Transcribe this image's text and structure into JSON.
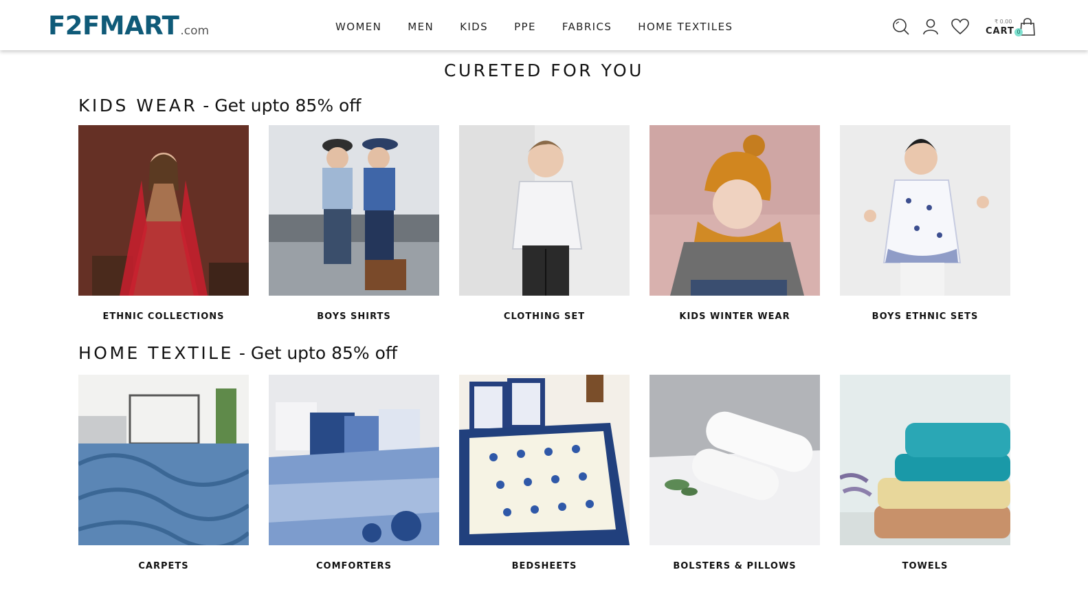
{
  "header": {
    "logo_main": "F2FMART",
    "logo_sub": ".com",
    "nav": [
      "WOMEN",
      "MEN",
      "KIDS",
      "PPE",
      "FABRICS",
      "HOME TEXTILES"
    ],
    "icons": [
      "search-icon",
      "account-icon",
      "wishlist-heart-icon",
      "shopping-bag-icon"
    ],
    "cart": {
      "amount": "₹ 0.00",
      "label": "CART",
      "count": "0"
    }
  },
  "page_title": "CURETED FOR YOU",
  "sections": [
    {
      "title_main": "KIDS WEAR",
      "title_offer": " -  Get upto 85% off",
      "items": [
        {
          "label": "ETHNIC COLLECTIONS"
        },
        {
          "label": "BOYS SHIRTS"
        },
        {
          "label": "CLOTHING SET"
        },
        {
          "label": "KIDS WINTER WEAR"
        },
        {
          "label": "BOYS ETHNIC SETS"
        }
      ]
    },
    {
      "title_main": "HOME TEXTILE",
      "title_offer": " -  Get upto 85% off",
      "items": [
        {
          "label": "CARPETS"
        },
        {
          "label": "COMFORTERS"
        },
        {
          "label": "BEDSHEETS"
        },
        {
          "label": "BOLSTERS & PILLOWS"
        },
        {
          "label": "TOWELS"
        }
      ]
    }
  ],
  "colors": {
    "brand": "#0f5a78",
    "cart_badge": "#7fe0cf",
    "text": "#111111"
  }
}
